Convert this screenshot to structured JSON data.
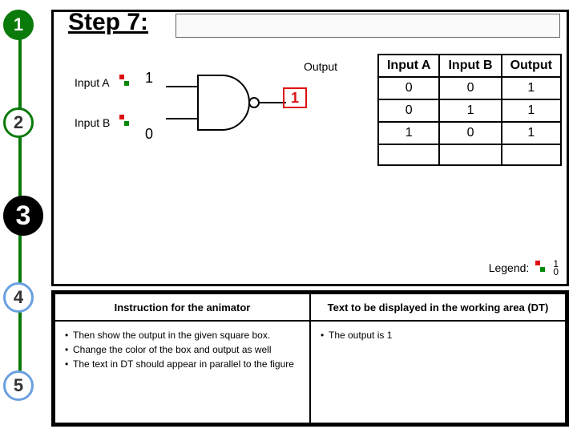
{
  "step_title": "Step 7:",
  "badges": [
    "1",
    "2",
    "3",
    "4",
    "5"
  ],
  "gate": {
    "inputA_label": "Input A",
    "inputB_label": "Input B",
    "output_label": "Output",
    "inputA_value": "1",
    "inputB_value": "0",
    "output_value": "1"
  },
  "truth_table": {
    "headers": [
      "Input A",
      "Input B",
      "Output"
    ],
    "rows": [
      [
        "0",
        "0",
        "1"
      ],
      [
        "0",
        "1",
        "1"
      ],
      [
        "1",
        "0",
        "1"
      ]
    ]
  },
  "legend": {
    "label": "Legend:",
    "hi": "1",
    "lo": "0"
  },
  "instructions": {
    "left_header": "Instruction for the animator",
    "right_header": "Text to be displayed in the working area (DT)",
    "left_items": [
      "Then show the output in the given square box.",
      "Change the color of the box and output as well",
      "The text in DT should appear  in parallel to the figure"
    ],
    "right_items": [
      "The output is 1"
    ]
  }
}
